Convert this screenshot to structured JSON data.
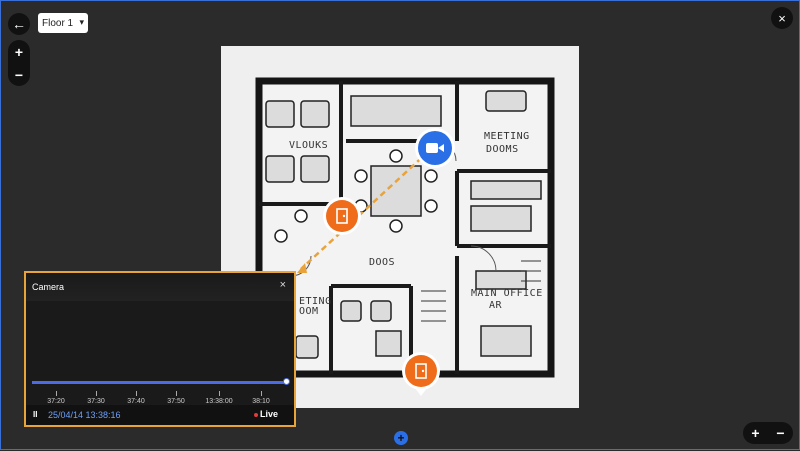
{
  "toolbar": {
    "back_icon": "←",
    "floor_select_value": "Floor 1",
    "close_icon": "×",
    "zoom_in": "+",
    "zoom_out": "−"
  },
  "floorplan": {
    "rooms": [
      {
        "label": "VLOUKS"
      },
      {
        "label": "MEETING"
      },
      {
        "label": "DOOMS"
      },
      {
        "label": "DOOS"
      },
      {
        "label": "ETING"
      },
      {
        "label": "OOM"
      },
      {
        "label": "MAIN OFFICE"
      },
      {
        "label": "AR"
      }
    ]
  },
  "camera_panel": {
    "title": "Camera",
    "close_icon": "×",
    "timeline_ticks": [
      "37:20",
      "37:30",
      "37:40",
      "37:50",
      "13:38:00",
      "38:10"
    ],
    "datetime": "25/04/14  13:38:16",
    "pause_icon": "II",
    "live_label": "Live"
  },
  "bottom_controls": {
    "zoom_in": "+",
    "zoom_out": "−",
    "center_icon": "+"
  },
  "colors": {
    "accent_blue": "#2b6fe6",
    "door_orange": "#ef6c1a",
    "panel_border": "#e8a33a",
    "live_red": "#e23b3b",
    "timeline_blue": "#4c6be6"
  }
}
